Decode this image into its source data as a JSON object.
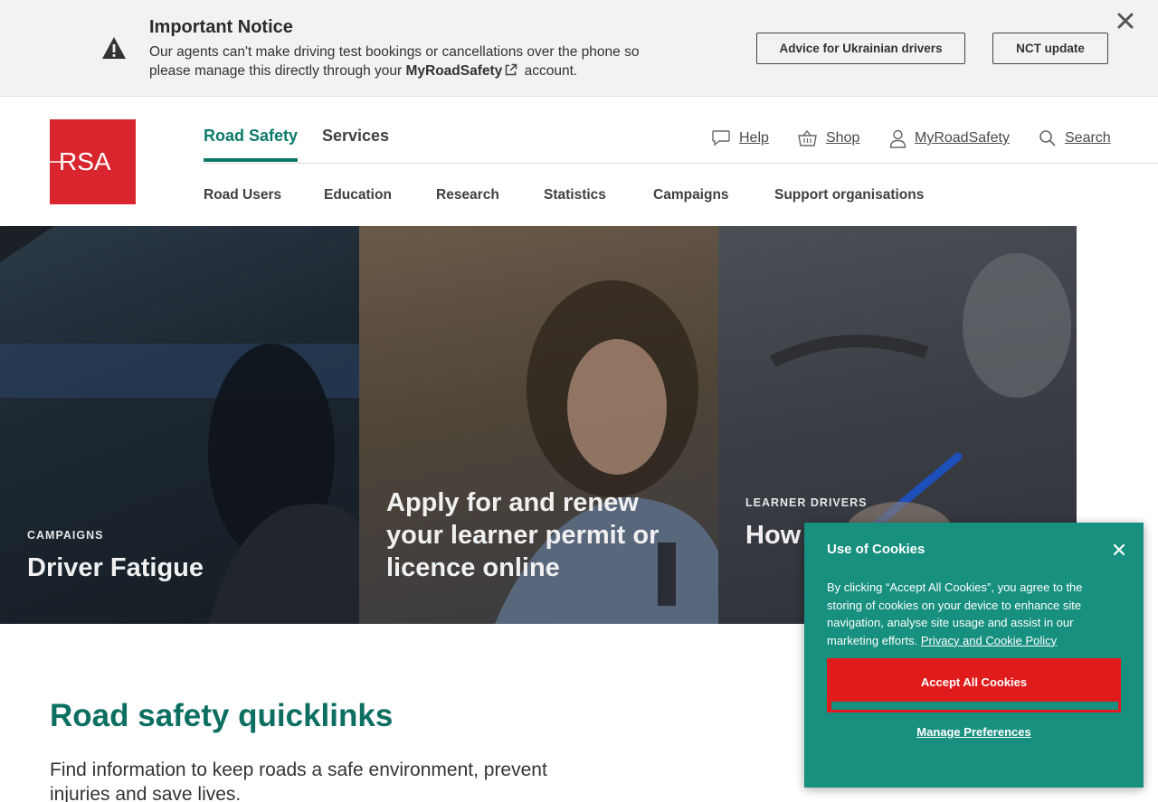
{
  "notice": {
    "title": "Important Notice",
    "body_prefix": "Our agents can't make driving test bookings or cancellations over the phone so please manage this directly through your",
    "link": "MyRoadSafety",
    "body_suffix": "account.",
    "buttons": [
      "Advice for Ukrainian drivers",
      "NCT update"
    ],
    "icons": {
      "warning": "warning-triangle-icon",
      "external": "external-link-icon",
      "close": "close-icon"
    }
  },
  "logo": {
    "text": "RSA",
    "color": "#d9262e"
  },
  "main_nav": [
    {
      "label": "Road Safety",
      "active": true
    },
    {
      "label": "Services",
      "active": false
    }
  ],
  "utility_nav": [
    {
      "label": "Help",
      "icon": "chat-bubble-icon"
    },
    {
      "label": "Shop",
      "icon": "basket-icon"
    },
    {
      "label": "MyRoadSafety",
      "icon": "user-icon"
    },
    {
      "label": "Search",
      "icon": "search-icon"
    }
  ],
  "sub_nav": [
    "Road Users",
    "Education",
    "Research",
    "Statistics",
    "Campaigns",
    "Support organisations"
  ],
  "hero_cards": [
    {
      "kicker": "CAMPAIGNS",
      "title": "Driver Fatigue"
    },
    {
      "kicker": "",
      "title": "Apply for and renew your learner permit or licence online"
    },
    {
      "kicker": "LEARNER DRIVERS",
      "title": "How ... drivi..."
    }
  ],
  "quicklinks": {
    "title": "Road safety quicklinks",
    "text": "Find information to keep roads a safe environment, prevent injuries and save lives."
  },
  "cookie": {
    "title": "Use of Cookies",
    "body": "By clicking “Accept All Cookies”, you agree to the storing of cookies on your device to enhance site navigation, analyse site usage and assist in our marketing efforts.",
    "policy_link": "Privacy and Cookie Policy",
    "accept": "Accept All Cookies",
    "manage": "Manage Preferences"
  },
  "colors": {
    "accent": "#0d7a6a",
    "brand_red": "#d9262e",
    "cookie_bg": "#17907f",
    "accept_red": "#e01b1b"
  }
}
